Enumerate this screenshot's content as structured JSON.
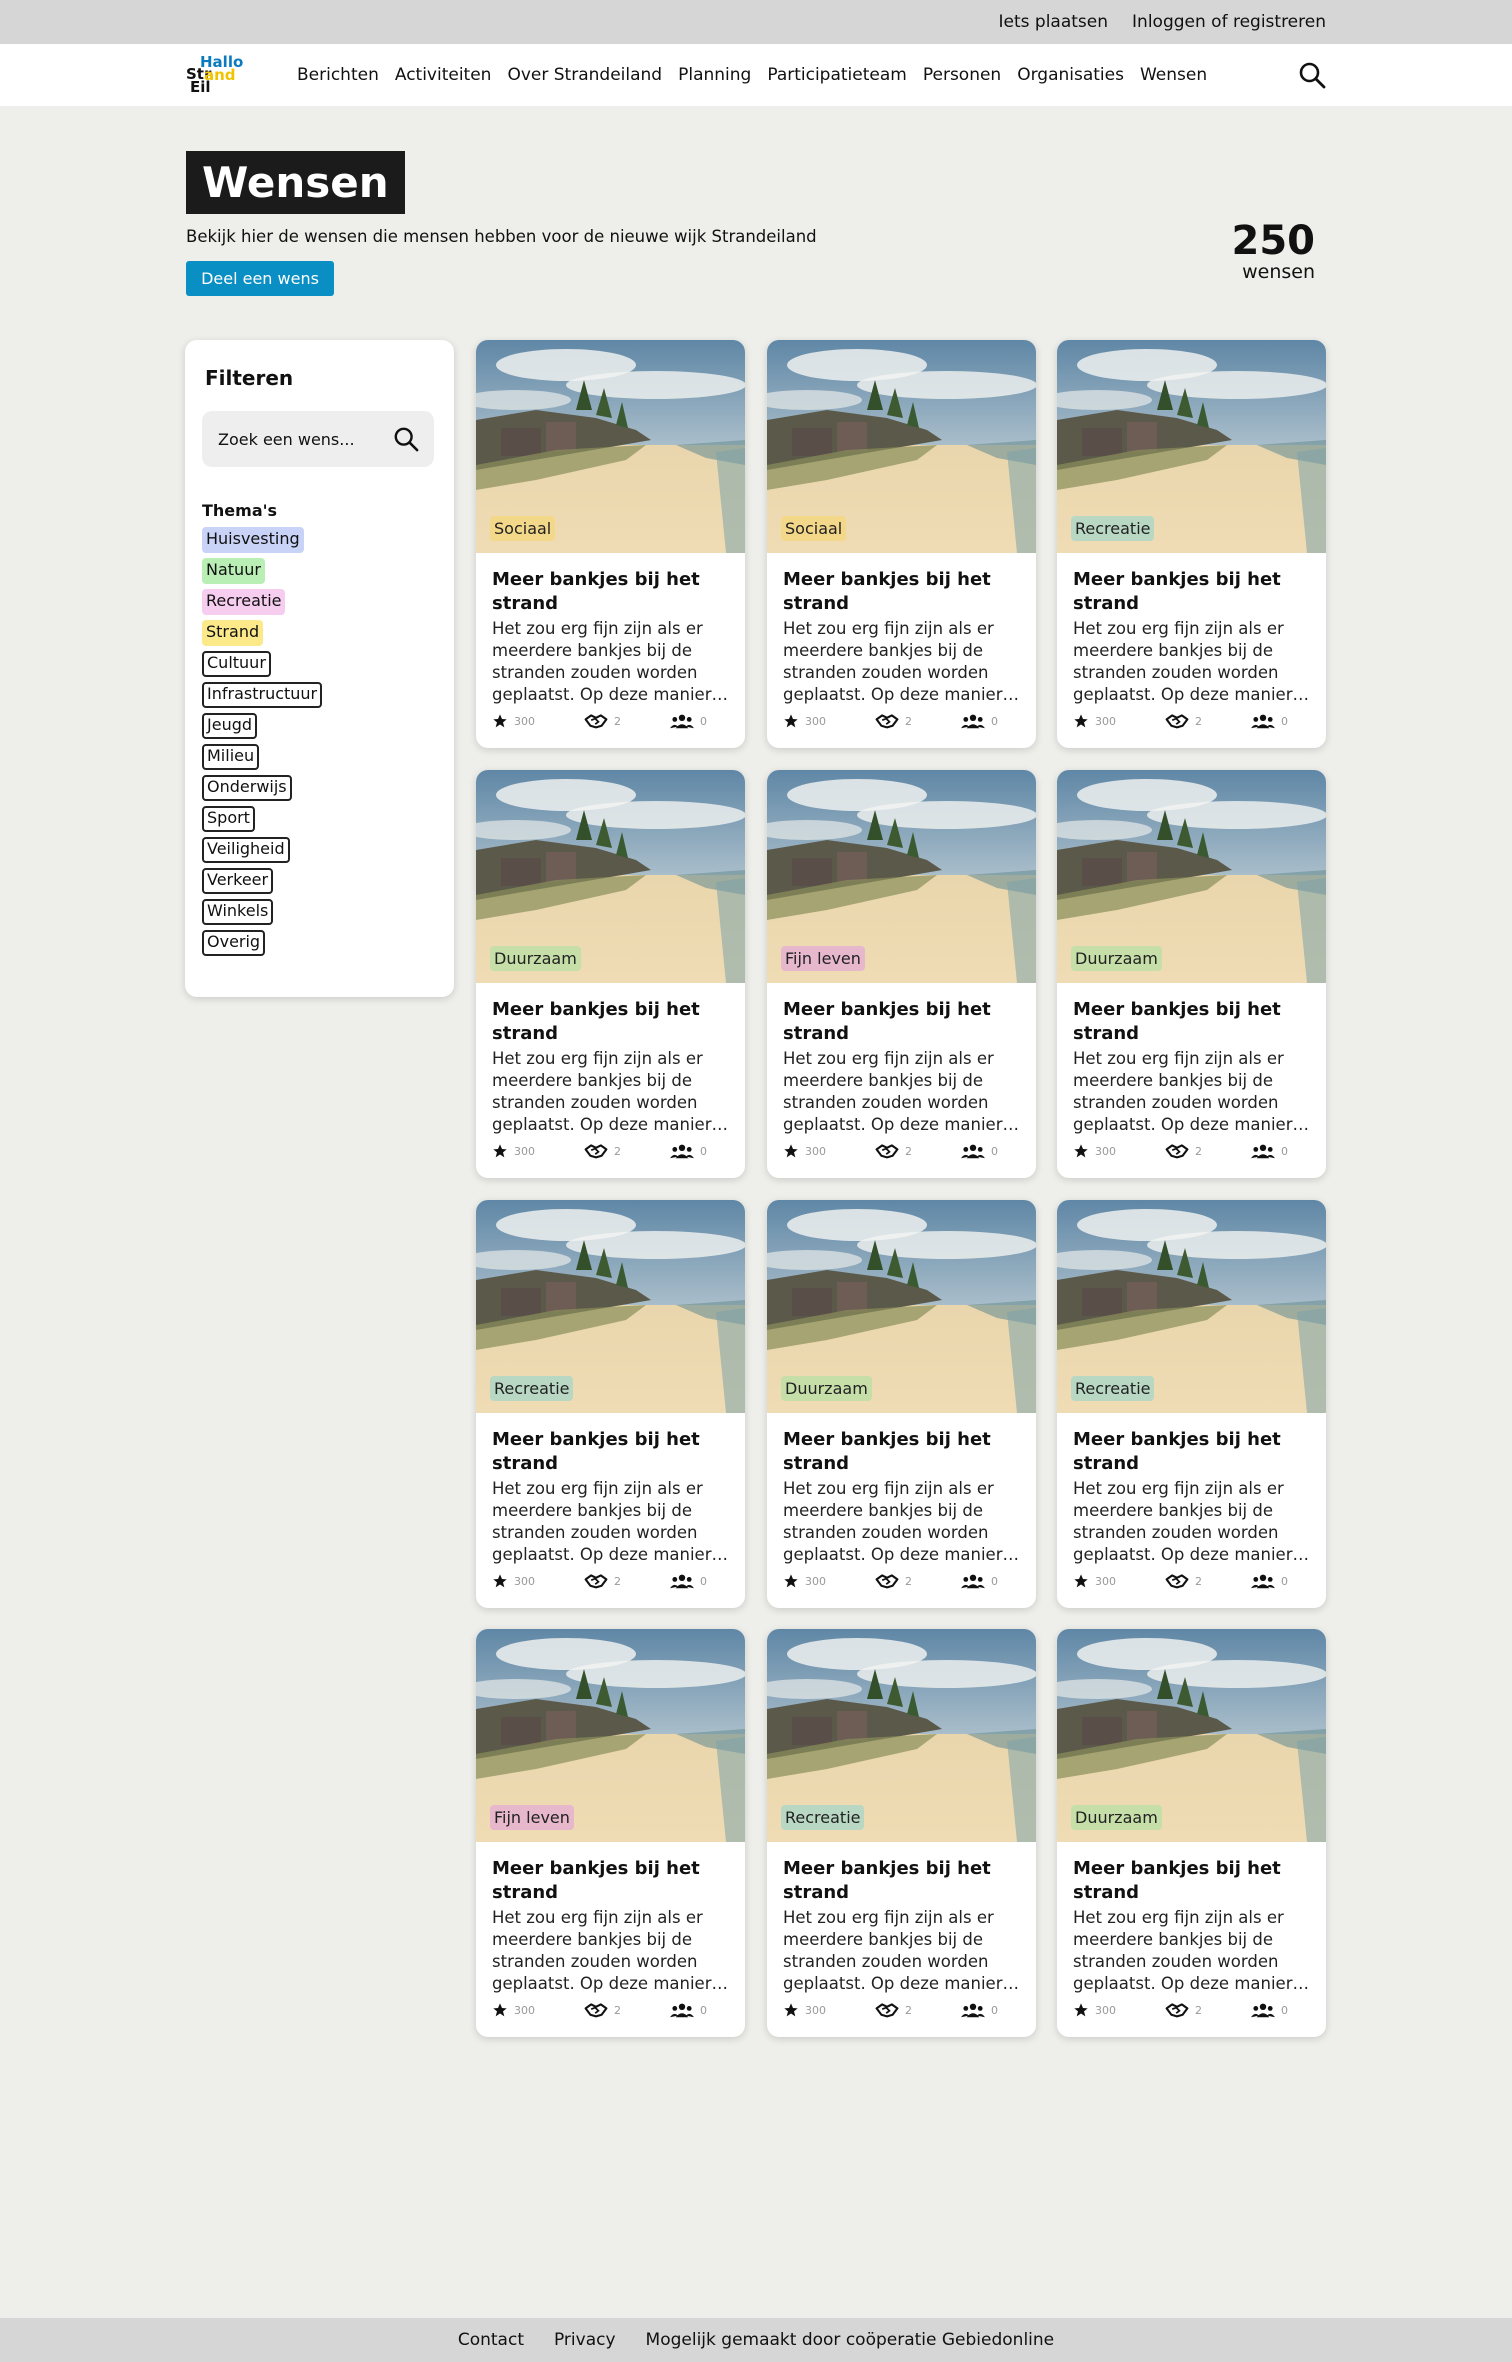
{
  "topbar": {
    "post_label": "Iets plaatsen",
    "login_label": "Inloggen of registreren"
  },
  "logo": {
    "line1": "Hallo",
    "line2a": "Str",
    "line2b": "and",
    "line3": "Eil"
  },
  "nav": {
    "items": [
      "Berichten",
      "Activiteiten",
      "Over Strandeiland",
      "Planning",
      "Participatieteam",
      "Personen",
      "Organisaties",
      "Wensen"
    ],
    "search_icon": "search-icon"
  },
  "header": {
    "title": "Wensen",
    "subtitle": "Bekijk hier de wensen die mensen hebben voor de nieuwe wijk Strandeiland",
    "share_button": "Deel een wens",
    "count_value": "250",
    "count_label": "wensen"
  },
  "filter": {
    "title": "Filteren",
    "search_placeholder": "Zoek een wens...",
    "themes_title": "Thema's",
    "themes": [
      {
        "label": "Huisvesting",
        "color": "#c9d3f7",
        "style": "filled"
      },
      {
        "label": "Natuur",
        "color": "#b9efb5",
        "style": "filled"
      },
      {
        "label": "Recreatie",
        "color": "#f6cdee",
        "style": "filled"
      },
      {
        "label": "Strand",
        "color": "#fbe98a",
        "style": "filled"
      },
      {
        "label": "Cultuur",
        "style": "outline"
      },
      {
        "label": "Infrastructuur",
        "style": "outline"
      },
      {
        "label": "Jeugd",
        "style": "outline"
      },
      {
        "label": "Milieu",
        "style": "outline"
      },
      {
        "label": "Onderwijs",
        "style": "outline"
      },
      {
        "label": "Sport",
        "style": "outline"
      },
      {
        "label": "Veiligheid",
        "style": "outline"
      },
      {
        "label": "Verkeer",
        "style": "outline"
      },
      {
        "label": "Winkels",
        "style": "outline"
      },
      {
        "label": "Overig",
        "style": "outline"
      }
    ]
  },
  "badge_colors": {
    "Sociaal": "#f3d88a",
    "Recreatie": "#b9d8c4",
    "Duurzaam": "#c6dfa8",
    "Fijn leven": "#e7b7cc"
  },
  "cards": [
    {
      "badge": "Sociaal",
      "title": "Meer bankjes bij het strand",
      "desc": "Het zou erg fijn zijn als er meerdere bankjes bij de stranden zouden worden geplaatst. Op deze manier…",
      "likes": "300",
      "supports": "2",
      "members": "0"
    },
    {
      "badge": "Sociaal",
      "title": "Meer bankjes bij het strand",
      "desc": "Het zou erg fijn zijn als er meerdere bankjes bij de stranden zouden worden geplaatst. Op deze manier…",
      "likes": "300",
      "supports": "2",
      "members": "0"
    },
    {
      "badge": "Recreatie",
      "title": "Meer bankjes bij het strand",
      "desc": "Het zou erg fijn zijn als er meerdere bankjes bij de stranden zouden worden geplaatst. Op deze manier…",
      "likes": "300",
      "supports": "2",
      "members": "0"
    },
    {
      "badge": "Duurzaam",
      "title": "Meer bankjes bij het strand",
      "desc": "Het zou erg fijn zijn als er meerdere bankjes bij de stranden zouden worden geplaatst. Op deze manier…",
      "likes": "300",
      "supports": "2",
      "members": "0"
    },
    {
      "badge": "Fijn leven",
      "title": "Meer bankjes bij het strand",
      "desc": "Het zou erg fijn zijn als er meerdere bankjes bij de stranden zouden worden geplaatst. Op deze manier…",
      "likes": "300",
      "supports": "2",
      "members": "0"
    },
    {
      "badge": "Duurzaam",
      "title": "Meer bankjes bij het strand",
      "desc": "Het zou erg fijn zijn als er meerdere bankjes bij de stranden zouden worden geplaatst. Op deze manier…",
      "likes": "300",
      "supports": "2",
      "members": "0"
    },
    {
      "badge": "Recreatie",
      "title": "Meer bankjes bij het strand",
      "desc": "Het zou erg fijn zijn als er meerdere bankjes bij de stranden zouden worden geplaatst. Op deze manier…",
      "likes": "300",
      "supports": "2",
      "members": "0"
    },
    {
      "badge": "Duurzaam",
      "title": "Meer bankjes bij het strand",
      "desc": "Het zou erg fijn zijn als er meerdere bankjes bij de stranden zouden worden geplaatst. Op deze manier…",
      "likes": "300",
      "supports": "2",
      "members": "0"
    },
    {
      "badge": "Recreatie",
      "title": "Meer bankjes bij het strand",
      "desc": "Het zou erg fijn zijn als er meerdere bankjes bij de stranden zouden worden geplaatst. Op deze manier…",
      "likes": "300",
      "supports": "2",
      "members": "0"
    },
    {
      "badge": "Fijn leven",
      "title": "Meer bankjes bij het strand",
      "desc": "Het zou erg fijn zijn als er meerdere bankjes bij de stranden zouden worden geplaatst. Op deze manier…",
      "likes": "300",
      "supports": "2",
      "members": "0"
    },
    {
      "badge": "Recreatie",
      "title": "Meer bankjes bij het strand",
      "desc": "Het zou erg fijn zijn als er meerdere bankjes bij de stranden zouden worden geplaatst. Op deze manier…",
      "likes": "300",
      "supports": "2",
      "members": "0"
    },
    {
      "badge": "Duurzaam",
      "title": "Meer bankjes bij het strand",
      "desc": "Het zou erg fijn zijn als er meerdere bankjes bij de stranden zouden worden geplaatst. Op deze manier…",
      "likes": "300",
      "supports": "2",
      "members": "0"
    }
  ],
  "footer": {
    "contact": "Contact",
    "privacy": "Privacy",
    "credit": "Mogelijk gemaakt door coöperatie Gebiedonline"
  },
  "colors": {
    "accent": "#0a8fc4",
    "page_bg": "#eeeeea",
    "bar_bg": "#d6d6d6"
  }
}
